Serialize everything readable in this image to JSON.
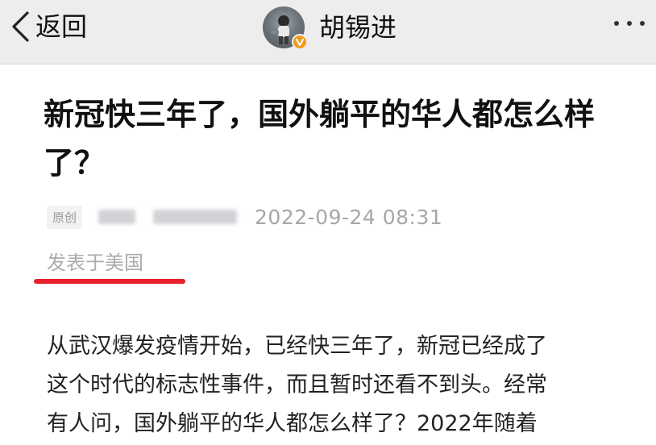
{
  "nav": {
    "back_label": "返回",
    "account_name": "胡锡进",
    "icons": [
      "chevron-left-icon",
      "verified-badge-icon",
      "more-dots-icon"
    ],
    "badge_color": "#f29b1d"
  },
  "article": {
    "title": "新冠快三年了，国外躺平的华人都怎么样了？",
    "original_tag": "原创",
    "publish_time": "2022-09-24 08:31",
    "location": "发表于美国",
    "highlight_color": "#e8202b",
    "body_lines": [
      "从武汉爆发疫情开始，已经快三年了，新冠已经成了",
      "这个时代的标志性事件，而且暂时还看不到头。经常",
      "有人问，国外躺平的华人都怎么样了？2022年随着"
    ]
  }
}
